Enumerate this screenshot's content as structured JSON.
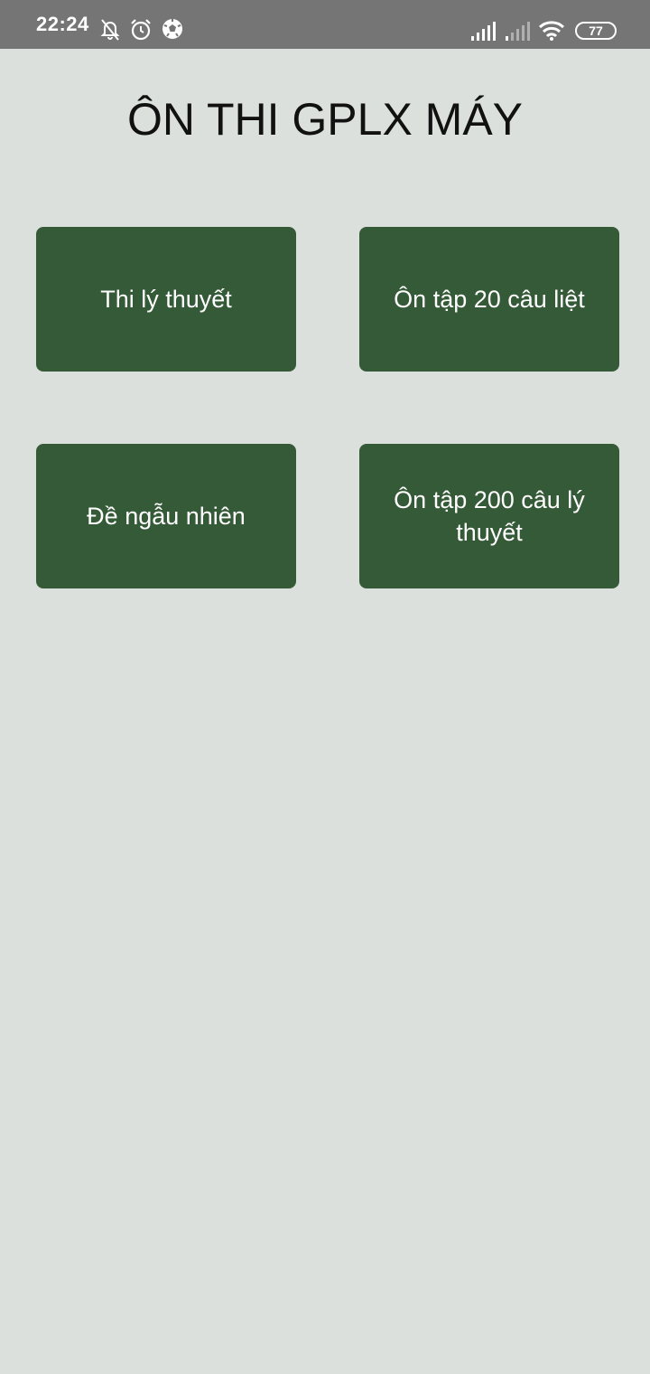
{
  "status_bar": {
    "time": "22:24",
    "battery": "77",
    "icons": [
      "bell-off-icon",
      "alarm-icon",
      "soccer-ball-icon",
      "signal-icon",
      "signal-weak-icon",
      "wifi-icon",
      "battery-icon"
    ],
    "color": "#757575"
  },
  "header": {
    "title": "ÔN THI GPLX MÁY"
  },
  "menu": {
    "btn_theory_exam": "Thi lý thuyết",
    "btn_review_20": "Ôn tập 20 câu liệt",
    "btn_random": "Đề ngẫu nhiên",
    "btn_review_200": "Ôn tập 200 câu lý thuyết",
    "button_color": "#355a37",
    "background_color": "#dbe0dd"
  }
}
